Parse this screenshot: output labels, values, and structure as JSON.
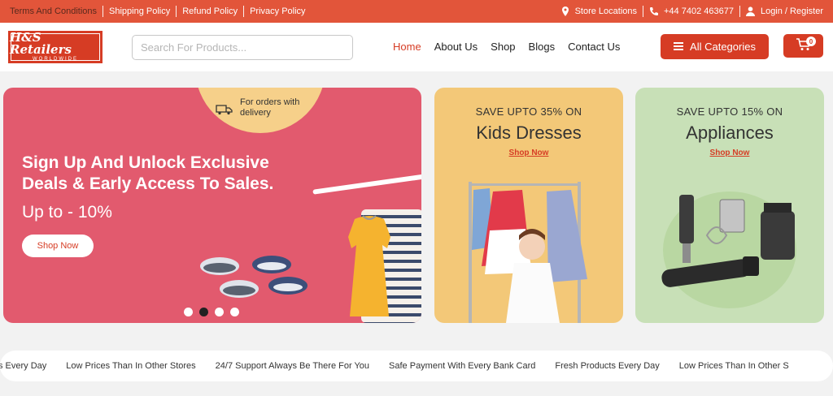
{
  "topbar": {
    "links": [
      "Terms And Conditions",
      "Shipping Policy",
      "Refund Policy",
      "Privacy Policy"
    ],
    "store_locations": "Store Locations",
    "phone": "+44 7402 463677",
    "login": "Login / Register"
  },
  "header": {
    "logo_line1": "H&S Retailers",
    "logo_line2": "WORLDWIDE",
    "search_placeholder": "Search For Products...",
    "nav": [
      "Home",
      "About Us",
      "Shop",
      "Blogs",
      "Contact Us"
    ],
    "categories_label": "All Categories",
    "cart_count": "0"
  },
  "hero": {
    "delivery_text": "For orders with delivery",
    "title": "Sign Up And Unlock Exclusive Deals & Early Access To Sales.",
    "subtitle": "Up to - 10%",
    "button": "Shop Now",
    "slides": 4,
    "active_slide": 2
  },
  "promos": [
    {
      "save": "SAVE UPTO 35% ON",
      "title": "Kids Dresses",
      "link": "Shop Now"
    },
    {
      "save": "SAVE UPTO 15% ON",
      "title": "Appliances",
      "link": "Shop Now"
    }
  ],
  "marquee": [
    "s Every Day",
    "Low Prices Than In Other Stores",
    "24/7 Support Always Be There For You",
    "Safe Payment With Every Bank Card",
    "Fresh Products Every Day",
    "Low Prices Than In Other S"
  ],
  "colors": {
    "accent": "#d63c24",
    "topbar": "#e2553a",
    "hero": "#e25a6e",
    "card1": "#f3c878",
    "card2": "#c8e0b7"
  }
}
